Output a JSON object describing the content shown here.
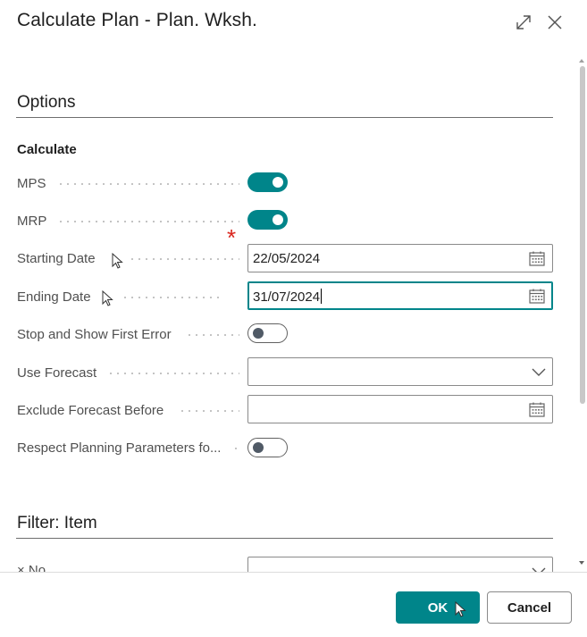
{
  "dialog": {
    "title": "Calculate Plan - Plan. Wksh."
  },
  "options": {
    "section_title": "Options",
    "group_title": "Calculate",
    "fields": {
      "mps": {
        "label": "MPS",
        "value": true
      },
      "mrp": {
        "label": "MRP",
        "value": true
      },
      "starting_date": {
        "label": "Starting Date",
        "value": "22/05/2024"
      },
      "ending_date": {
        "label": "Ending Date",
        "value": "31/07/2024",
        "required_mark": "*"
      },
      "stop_first_error": {
        "label": "Stop and Show First Error",
        "value": false
      },
      "use_forecast": {
        "label": "Use Forecast",
        "value": ""
      },
      "exclude_forecast_before": {
        "label": "Exclude Forecast Before",
        "value": ""
      },
      "respect_planning": {
        "label": "Respect Planning Parameters fo...",
        "value": false
      }
    }
  },
  "filter": {
    "section_title": "Filter: Item",
    "first_field_label": "× No."
  },
  "footer": {
    "ok_label": "OK",
    "cancel_label": "Cancel"
  },
  "colors": {
    "accent": "#00858a",
    "required": "#d9241c"
  }
}
